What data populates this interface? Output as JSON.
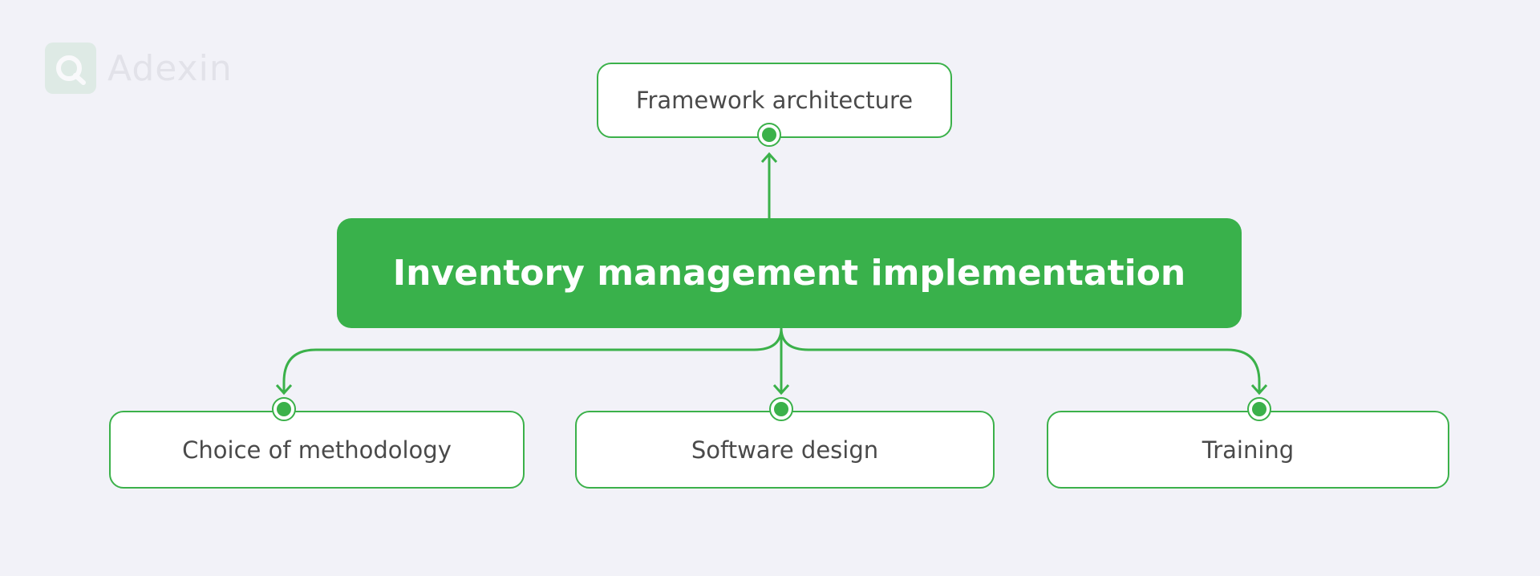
{
  "logo": {
    "text": "Adexin",
    "icon": "adexin-logo-icon"
  },
  "central_node": {
    "label": "Inventory management implementation"
  },
  "top_node": {
    "label": "Framework architecture"
  },
  "bottom_nodes": [
    {
      "label": "Choice of methodology"
    },
    {
      "label": "Software design"
    },
    {
      "label": "Training"
    }
  ],
  "colors": {
    "accent": "#39b14b",
    "background": "#f2f2f8",
    "node_text": "#4a4a4a",
    "logo_text": "#d6d6de"
  }
}
